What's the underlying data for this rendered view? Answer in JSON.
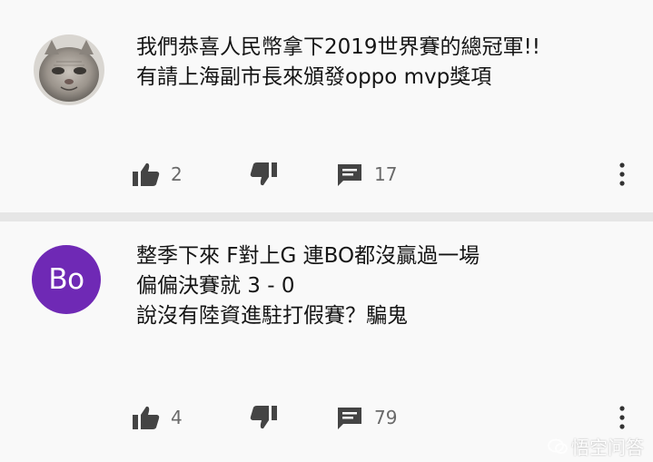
{
  "comments": [
    {
      "avatar": {
        "type": "photo",
        "description_icon": "cat-avatar-icon"
      },
      "lines": [
        "我們恭喜人民幣拿下2019世界賽的總冠軍!!",
        "有請上海副市長來頒發oppo mvp獎項"
      ],
      "likes": "2",
      "replies": "17"
    },
    {
      "avatar": {
        "type": "letters",
        "letters": "Bo",
        "color": "#6f29b5"
      },
      "lines": [
        "整季下來 F對上G 連BO都沒贏過一場",
        "偏偏決賽就 3 - 0",
        "說沒有陸資進駐打假賽？騙鬼"
      ],
      "likes": "4",
      "replies": "79"
    }
  ],
  "icons": {
    "like": "thumbs-up-icon",
    "dislike": "thumbs-down-icon",
    "reply": "comment-icon",
    "more": "more-vertical-icon"
  },
  "watermark": {
    "text": "悟空问答"
  }
}
